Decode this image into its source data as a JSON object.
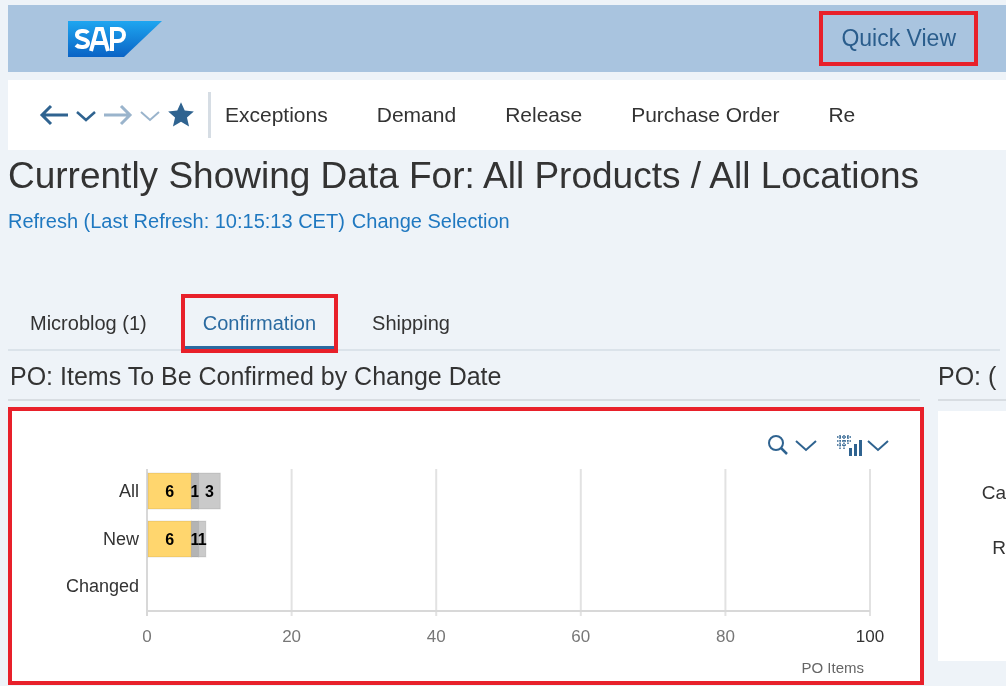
{
  "shell": {
    "quick_view": {
      "label": "Quick View",
      "highlighted": true
    }
  },
  "nav": {
    "items": [
      {
        "label": "Exceptions"
      },
      {
        "label": "Demand"
      },
      {
        "label": "Release"
      },
      {
        "label": "Purchase Order"
      },
      {
        "label": "Re"
      }
    ]
  },
  "header": {
    "title": "Currently Showing Data For: All Products / All Locations",
    "refresh_link": "Refresh (Last Refresh: 10:15:13 CET)",
    "change_link": "Change Selection"
  },
  "tabs": [
    {
      "label": "Microblog (1)",
      "selected": false,
      "highlighted": false
    },
    {
      "label": "Confirmation",
      "selected": true,
      "highlighted": true
    },
    {
      "label": "Shipping",
      "selected": false,
      "highlighted": false
    }
  ],
  "panels": [
    {
      "title": "PO: Items To Be Confirmed by Change Date",
      "highlighted": true,
      "chart_data": {
        "type": "bar",
        "orientation": "horizontal",
        "stacked": true,
        "xlabel": "PO Items",
        "categories": [
          "All",
          "New",
          "Changed"
        ],
        "xlim": [
          0,
          100
        ],
        "xticks": [
          0,
          20,
          40,
          60,
          80,
          100
        ],
        "data_labels": true,
        "grid": true,
        "series": [
          {
            "color": "#ffd66e",
            "values": [
              6,
              6,
              null
            ]
          },
          {
            "color": "#b4b4b4",
            "values": [
              1,
              1,
              null
            ]
          },
          {
            "color": "#cacaca",
            "values": [
              3,
              1,
              null
            ]
          }
        ]
      }
    },
    {
      "title": "PO: (",
      "labels": [
        "Ca",
        "R"
      ]
    }
  ]
}
